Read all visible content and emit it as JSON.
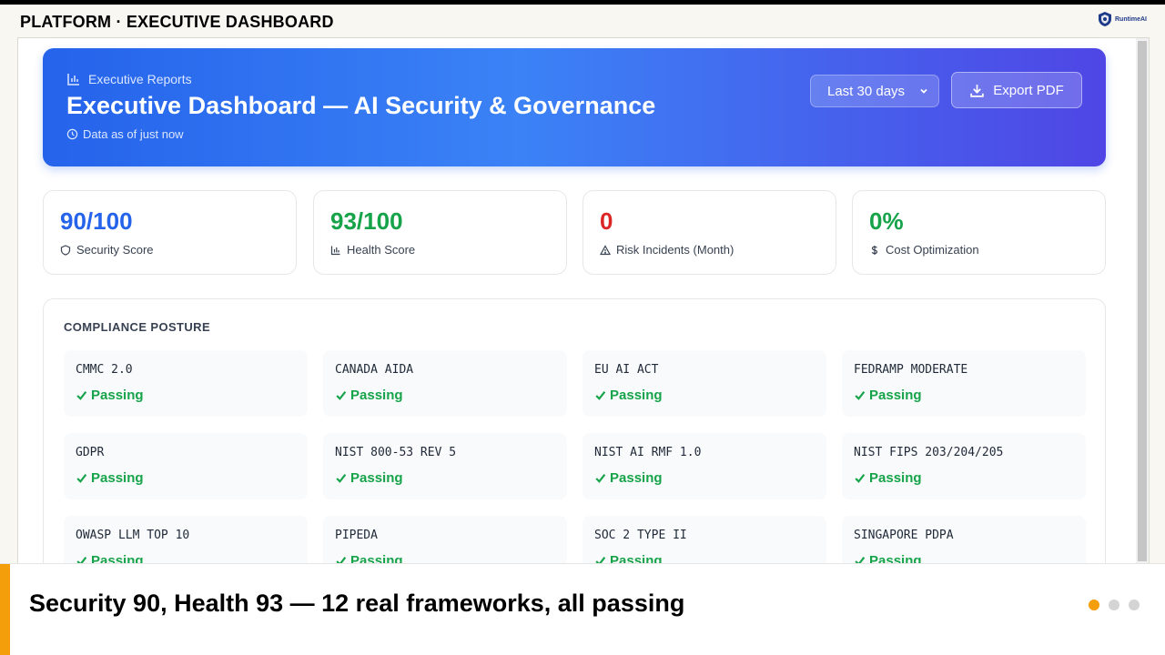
{
  "slide": {
    "header": "PLATFORM · EXECUTIVE DASHBOARD",
    "brand_name": "RuntimeAI",
    "caption": "Security 90, Health 93 — 12 real frameworks, all passing",
    "pagination": {
      "total": 3,
      "active_index": 0
    },
    "accent_color": "#f59e0b"
  },
  "hero": {
    "kicker": "Executive Reports",
    "title": "Executive Dashboard — AI Security & Governance",
    "data_freshness": "Data as of just now",
    "range_select": {
      "value": "Last 30 days"
    },
    "export_label": "Export PDF",
    "gradient_colors": [
      "#2563eb",
      "#3b82f6",
      "#4f46e5"
    ]
  },
  "kpis": [
    {
      "value": "90/100",
      "label": "Security Score",
      "icon": "shield-icon",
      "color": "#2563eb"
    },
    {
      "value": "93/100",
      "label": "Health Score",
      "icon": "bar-chart-icon",
      "color": "#16a34a"
    },
    {
      "value": "0",
      "label": "Risk Incidents (Month)",
      "icon": "warning-icon",
      "color": "#dc2626"
    },
    {
      "value": "0%",
      "label": "Cost Optimization",
      "icon": "dollar-icon",
      "color": "#16a34a"
    }
  ],
  "compliance": {
    "title": "COMPLIANCE POSTURE",
    "status_color": "#16a34a",
    "frameworks": [
      {
        "name": "CMMC 2.0",
        "status": "Passing"
      },
      {
        "name": "CANADA AIDA",
        "status": "Passing"
      },
      {
        "name": "EU AI ACT",
        "status": "Passing"
      },
      {
        "name": "FEDRAMP MODERATE",
        "status": "Passing"
      },
      {
        "name": "GDPR",
        "status": "Passing"
      },
      {
        "name": "NIST 800-53 REV 5",
        "status": "Passing"
      },
      {
        "name": "NIST AI RMF 1.0",
        "status": "Passing"
      },
      {
        "name": "NIST FIPS 203/204/205",
        "status": "Passing"
      },
      {
        "name": "OWASP LLM TOP 10",
        "status": "Passing"
      },
      {
        "name": "PIPEDA",
        "status": "Passing"
      },
      {
        "name": "SOC 2 TYPE II",
        "status": "Passing"
      },
      {
        "name": "SINGAPORE PDPA",
        "status": "Passing"
      }
    ]
  }
}
